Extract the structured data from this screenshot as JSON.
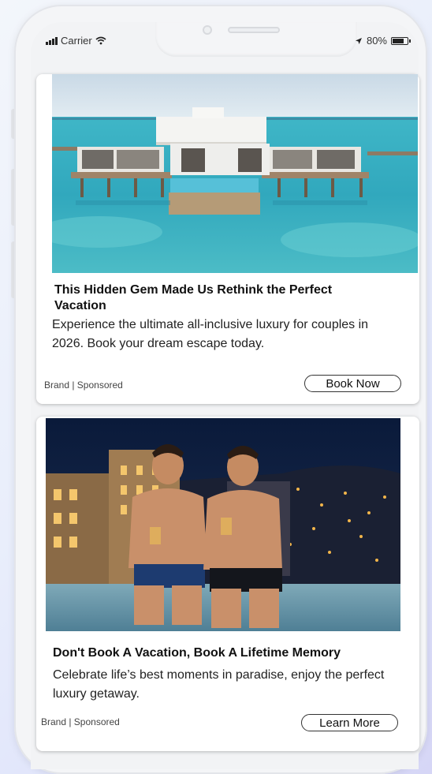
{
  "status_bar": {
    "carrier": "Carrier",
    "battery": "80%",
    "battery_level": 0.8
  },
  "ads": [
    {
      "title": "This Hidden Gem Made Us Rethink the Perfect Vacation",
      "description": "Experience the ultimate all-inclusive luxury for couples in 2026. Book your dream escape today.",
      "brand": "Brand | Sponsored",
      "cta": "Book Now"
    },
    {
      "title": "Don't Book A Vacation, Book A Lifetime Memory",
      "description": "Celebrate life’s best moments in paradise, enjoy the perfect luxury getaway.",
      "brand": "Brand | Sponsored",
      "cta": "Learn More"
    }
  ]
}
